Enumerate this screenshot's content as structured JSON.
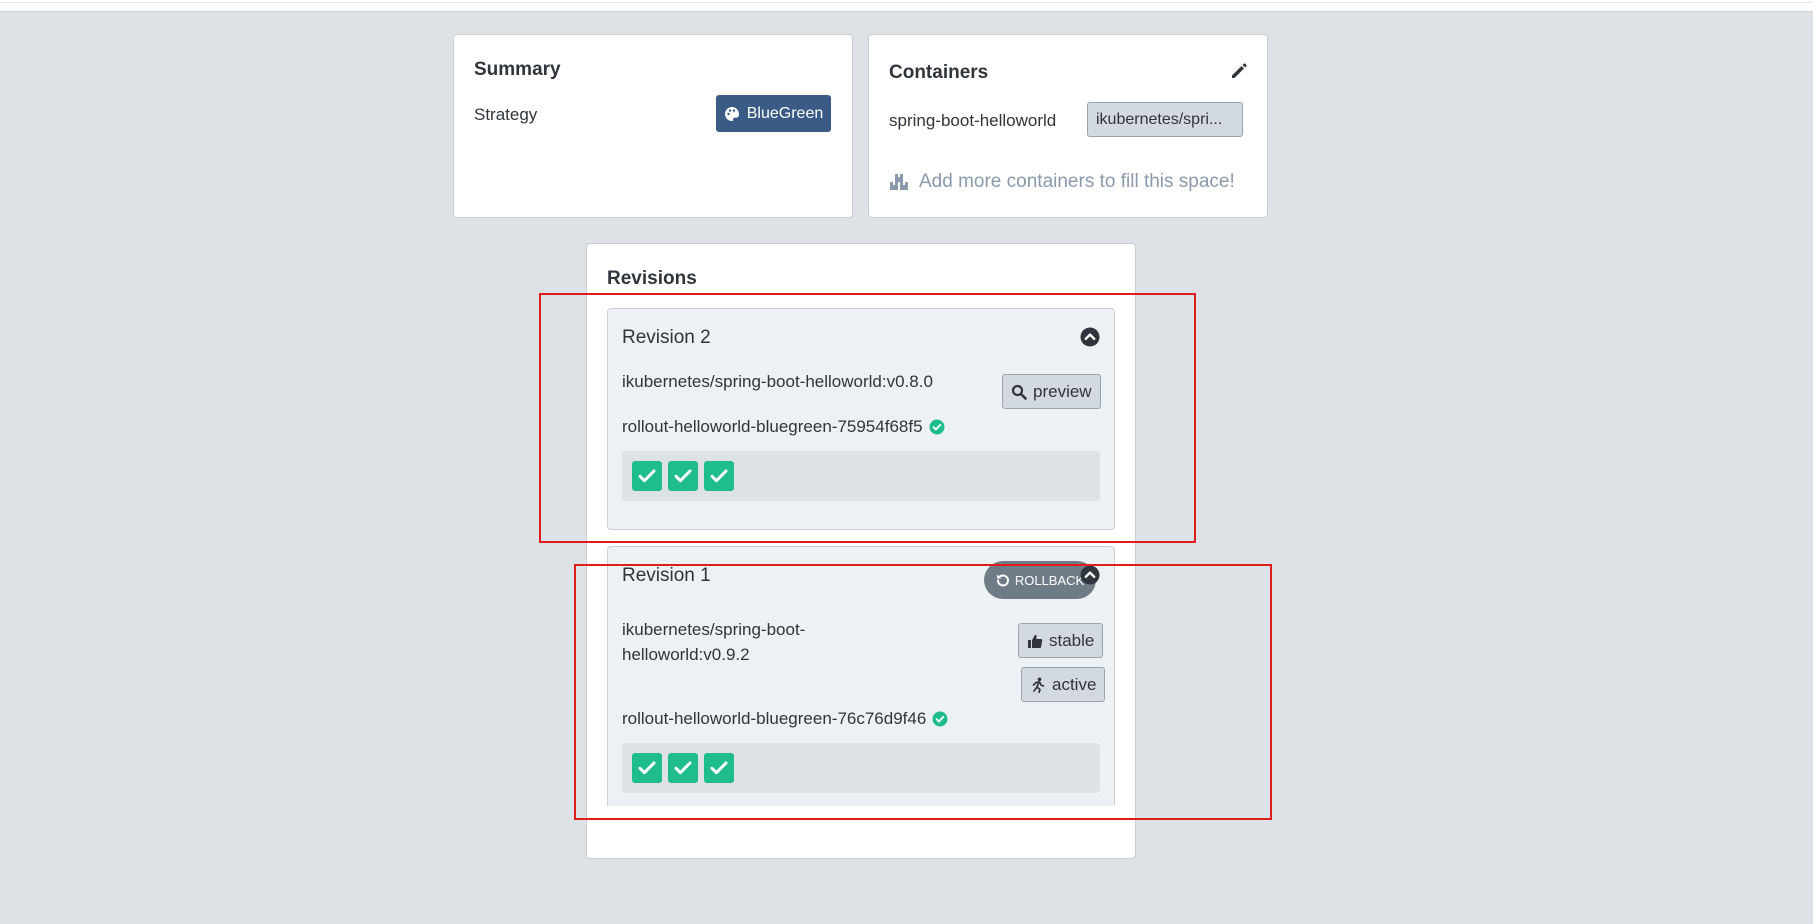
{
  "summary": {
    "title": "Summary",
    "strategy_label": "Strategy",
    "strategy_value": "BlueGreen",
    "strategy_icon": "palette-icon"
  },
  "containers": {
    "title": "Containers",
    "edit_icon": "pencil-icon",
    "items": [
      {
        "name": "spring-boot-helloworld",
        "image": "ikubernetes/spri..."
      }
    ],
    "add_more_text": "Add more containers to fill this space!",
    "add_more_icon": "boxes-icon"
  },
  "revisions": {
    "title": "Revisions",
    "items": [
      {
        "title": "Revision 2",
        "image": "ikubernetes/spring-boot-helloworld:v0.8.0",
        "tags": [
          {
            "label": "preview",
            "icon": "search-icon"
          }
        ],
        "replicaset": "rollout-helloworld-bluegreen-75954f68f5",
        "replicaset_status": "healthy",
        "pods": [
          "ready",
          "ready",
          "ready"
        ]
      },
      {
        "title": "Revision 1",
        "rollback_label": "ROLLBACK",
        "image_line1": "ikubernetes/spring-boot-",
        "image_line2": "helloworld:v0.9.2",
        "tags": [
          {
            "label": "stable",
            "icon": "thumbs-up-icon"
          },
          {
            "label": "active",
            "icon": "running-icon"
          }
        ],
        "replicaset": "rollout-helloworld-bluegreen-76c76d9f46",
        "replicaset_status": "healthy",
        "pods": [
          "ready",
          "ready",
          "ready"
        ]
      }
    ]
  },
  "colors": {
    "background": "#dee2e7",
    "strategy_badge": "#3a5b85",
    "pod_ready": "#1fbc8c",
    "highlight": "#e01d1d",
    "rollback": "#6f7c88"
  }
}
